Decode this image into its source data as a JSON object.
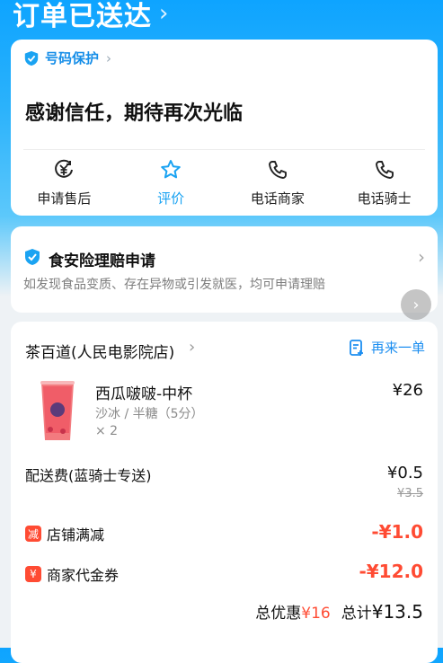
{
  "header": {
    "title": "订单已送达",
    "chevron": "›"
  },
  "protection": {
    "label": "号码保护",
    "chevron": "›"
  },
  "thanks": "感谢信任，期待再次光临",
  "actions": [
    {
      "icon": "yuan-circle-icon",
      "label": "申请售后"
    },
    {
      "icon": "star-icon",
      "label": "评价"
    },
    {
      "icon": "phone-icon",
      "label": "电话商家"
    },
    {
      "icon": "phone-icon",
      "label": "电话骑士"
    }
  ],
  "insurance": {
    "title": "食安险理赔申请",
    "description": "如发现食品变质、存在异物或引发就医，均可申请理赔",
    "chevron": "›"
  },
  "order": {
    "shop": "茶百道(人民电影院店)",
    "shop_chevron": "›",
    "reorder": "再来一单",
    "item": {
      "name": "西瓜啵啵-中杯",
      "spec": "沙冰 / 半糖（5分）",
      "qty": "× 2",
      "price": "¥26"
    },
    "delivery": {
      "label": "配送费(蓝骑士专送)",
      "price": "¥0.5",
      "original": "¥3.5"
    },
    "discounts": [
      {
        "badge": "减",
        "label": "店铺满减",
        "value": "-¥1.0"
      },
      {
        "badge": "¥",
        "label": "商家代金券",
        "value": "-¥12.0"
      }
    ],
    "total": {
      "discount_label": "总优惠",
      "discount_value": "¥16",
      "sum_label": "总计",
      "sum_value": "¥13.5"
    }
  },
  "colors": {
    "accent": "#1aa3f2",
    "discount": "#ff4b33",
    "header_bg": "#0ea4ff"
  }
}
